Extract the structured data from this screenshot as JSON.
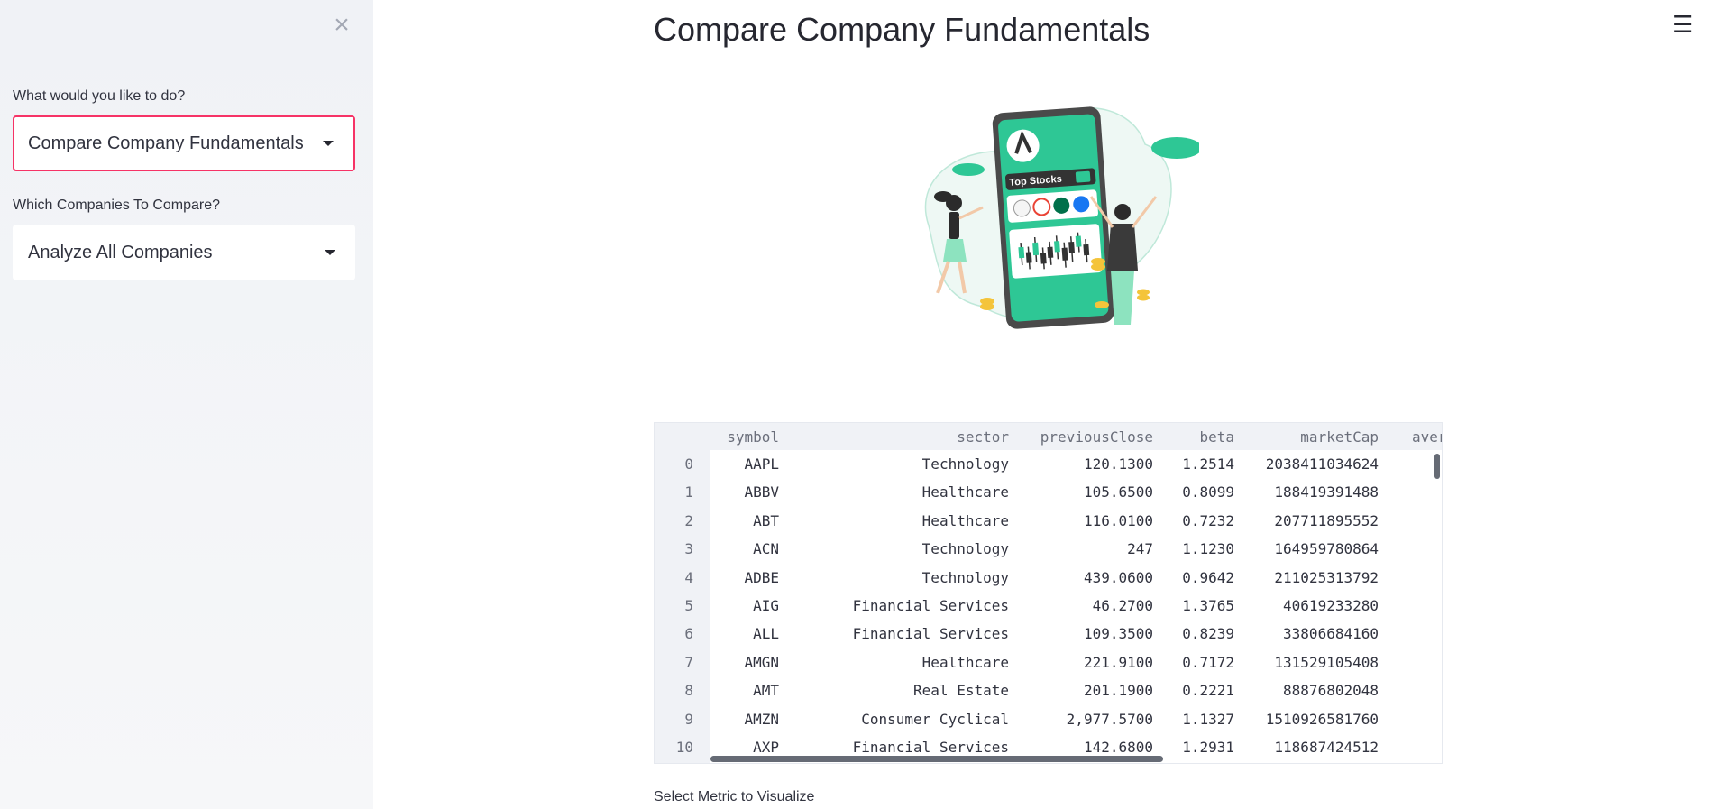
{
  "sidebar": {
    "close_icon": "close-icon",
    "action_label": "What would you like to do?",
    "action_value": "Compare Company Fundamentals",
    "companies_label": "Which Companies To Compare?",
    "companies_value": "Analyze All Companies"
  },
  "main": {
    "menu_icon": "hamburger-menu-icon",
    "title": "Compare Company Fundamentals",
    "illustration_caption": "Top Stocks",
    "select_metric_label": "Select Metric to Visualize"
  },
  "table": {
    "columns": [
      "symbol",
      "sector",
      "previousClose",
      "beta",
      "marketCap",
      "aver"
    ],
    "rows": [
      {
        "index": "0",
        "symbol": "AAPL",
        "sector": "Technology",
        "previousClose": "120.1300",
        "beta": "1.2514",
        "marketCap": "2038411034624"
      },
      {
        "index": "1",
        "symbol": "ABBV",
        "sector": "Healthcare",
        "previousClose": "105.6500",
        "beta": "0.8099",
        "marketCap": "188419391488"
      },
      {
        "index": "2",
        "symbol": "ABT",
        "sector": "Healthcare",
        "previousClose": "116.0100",
        "beta": "0.7232",
        "marketCap": "207711895552"
      },
      {
        "index": "3",
        "symbol": "ACN",
        "sector": "Technology",
        "previousClose": "247",
        "beta": "1.1230",
        "marketCap": "164959780864"
      },
      {
        "index": "4",
        "symbol": "ADBE",
        "sector": "Technology",
        "previousClose": "439.0600",
        "beta": "0.9642",
        "marketCap": "211025313792"
      },
      {
        "index": "5",
        "symbol": "AIG",
        "sector": "Financial Services",
        "previousClose": "46.2700",
        "beta": "1.3765",
        "marketCap": "40619233280"
      },
      {
        "index": "6",
        "symbol": "ALL",
        "sector": "Financial Services",
        "previousClose": "109.3500",
        "beta": "0.8239",
        "marketCap": "33806684160"
      },
      {
        "index": "7",
        "symbol": "AMGN",
        "sector": "Healthcare",
        "previousClose": "221.9100",
        "beta": "0.7172",
        "marketCap": "131529105408"
      },
      {
        "index": "8",
        "symbol": "AMT",
        "sector": "Real Estate",
        "previousClose": "201.1900",
        "beta": "0.2221",
        "marketCap": "88876802048"
      },
      {
        "index": "9",
        "symbol": "AMZN",
        "sector": "Consumer Cyclical",
        "previousClose": "2,977.5700",
        "beta": "1.1327",
        "marketCap": "1510926581760"
      },
      {
        "index": "10",
        "symbol": "AXP",
        "sector": "Financial Services",
        "previousClose": "142.6800",
        "beta": "1.2931",
        "marketCap": "118687424512"
      }
    ]
  },
  "colors": {
    "accent": "#f63366",
    "sidebar_bg": "#f0f2f6",
    "illustration_green": "#2ec795"
  }
}
